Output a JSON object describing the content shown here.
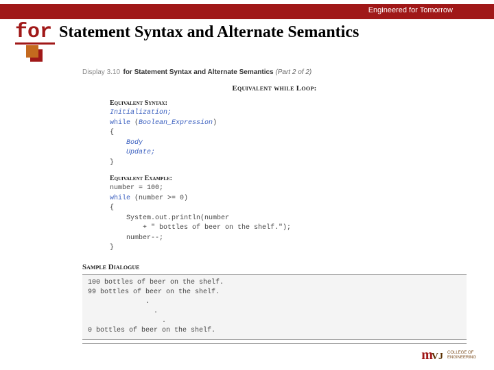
{
  "header": {
    "tagline": "Engineered for Tomorrow",
    "keyword": "for",
    "title_rest": "Statement Syntax and Alternate Semantics"
  },
  "display": {
    "num": "Display 3.10",
    "title": "for Statement Syntax and Alternate Semantics",
    "part": "(Part 2 of 2)"
  },
  "sections": {
    "eq_loop": "Equivalent while Loop:",
    "eq_syntax": "Equivalent Syntax:",
    "eq_example": "Equivalent Example:",
    "sample": "Sample Dialogue"
  },
  "syntax": {
    "l1": "Initialization;",
    "l2a": "while",
    "l2b": " (",
    "l2c": "Boolean_Expression",
    "l2d": ")",
    "l3": "{",
    "l4": "    Body",
    "l5": "    Update;",
    "l6": "}"
  },
  "example": {
    "l1": "number = 100;",
    "l2a": "while",
    "l2b": " (number >= 0)",
    "l3": "{",
    "l4": "    System.out.println(number",
    "l5": "        + \" bottles of beer on the shelf.\");",
    "l6": "    number--;",
    "l7": "}"
  },
  "sample": {
    "l1": "100 bottles of beer on the shelf.",
    "l2": "99 bottles of beer on the shelf.",
    "l3": "              .",
    "l4": "                .",
    "l5": "                  .",
    "l6": "0 bottles of beer on the shelf."
  },
  "footer": {
    "m": "m",
    "vj": "VJ",
    "line1": "College of",
    "line2": "Engineering"
  }
}
